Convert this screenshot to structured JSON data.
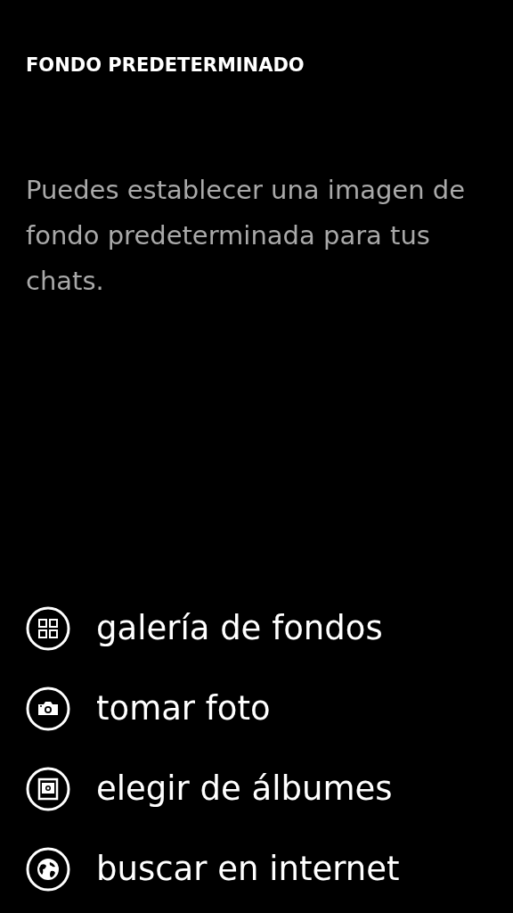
{
  "title": "FONDO PREDETERMINADO",
  "description": "Puedes establecer una imagen de fondo predeterminada para tus chats.",
  "options": [
    {
      "kind": "gallery",
      "label": "galería de fondos"
    },
    {
      "kind": "camera",
      "label": "tomar foto"
    },
    {
      "kind": "album",
      "label": "elegir de álbumes"
    },
    {
      "kind": "web",
      "label": "buscar en internet"
    }
  ]
}
